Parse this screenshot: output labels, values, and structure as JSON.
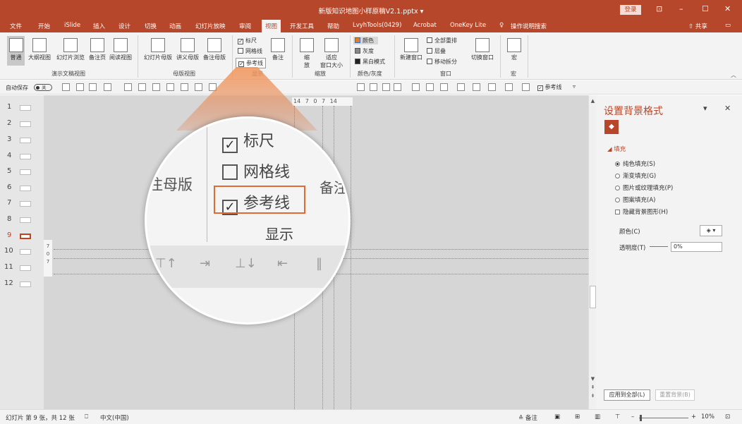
{
  "window": {
    "title": "新版知识地图小样原稿V2.1.pptx  ▾",
    "login_label": "登录",
    "controls": [
      "⊡",
      "–",
      "☐",
      "✕"
    ]
  },
  "menu": {
    "tabs": [
      "文件",
      "开始",
      "iSlide",
      "插入",
      "设计",
      "切换",
      "动画",
      "幻灯片放映",
      "审阅",
      "视图",
      "开发工具",
      "帮助",
      "LvyhTools(0429)",
      "Acrobat",
      "OneKey Lite"
    ],
    "active_tab": "视图",
    "search": "操作说明搜索",
    "share": "共享"
  },
  "ribbon": {
    "normal": "普通",
    "outline": "大纲视图",
    "sorter": "幻灯片浏览",
    "notes_page": "备注页",
    "reading": "阅读视图",
    "group_views": "演示文稿视图",
    "slide_master": "幻灯片母版",
    "handout_master": "讲义母版",
    "notes_master": "备注母版",
    "group_master": "母版视图",
    "ruler": "标尺",
    "gridlines": "网格线",
    "guides": "参考线",
    "notes": "备注",
    "group_show": "显示",
    "zoom": "缩\n放",
    "fit_window": "适应\n窗口大小",
    "group_zoom": "缩放",
    "color": "颜色",
    "grayscale": "灰度",
    "bw": "黑白模式",
    "group_color": "颜色/灰度",
    "new_window": "新建窗口",
    "arrange_all": "全部重排",
    "cascade": "层叠",
    "move_split": "移动拆分",
    "switch_window": "切换窗口",
    "group_window": "窗口",
    "macros": "宏",
    "group_macros": "宏"
  },
  "qat": {
    "autosave_label": "自动保存",
    "autosave_state": "关",
    "guides_check": "参考线"
  },
  "thumbnails": [
    "1",
    "2",
    "3",
    "4",
    "5",
    "6",
    "7",
    "8",
    "9",
    "10",
    "11",
    "12"
  ],
  "active_slide": "9",
  "ruler_text": "14  7  0  7  14",
  "vruler_text": "7\n0\n7",
  "magnifier": {
    "ruler": "标尺",
    "gridlines": "网格线",
    "guides": "参考线",
    "group": "显示",
    "left_label": "注母版",
    "right_label": "备注"
  },
  "format_pane": {
    "title": "设置背景格式",
    "section": "填充",
    "options": [
      {
        "label": "纯色填充(S)",
        "selected": true
      },
      {
        "label": "渐变填充(G)",
        "selected": false
      },
      {
        "label": "图片或纹理填充(P)",
        "selected": false
      },
      {
        "label": "图案填充(A)",
        "selected": false
      }
    ],
    "hide_bg": "隐藏背景图形(H)",
    "color_label": "颜色(C)",
    "transparency_label": "透明度(T)",
    "transparency_value": "0%",
    "apply_all": "应用到全部(L)",
    "reset": "重置背景(B)"
  },
  "status": {
    "slide_info": "幻灯片 第 9 张，共 12 张",
    "language": "中文(中国)",
    "notes": "≙ 备注",
    "zoom": "10%"
  },
  "colors": {
    "accent": "#b7472a",
    "highlight": "#e06a2f",
    "panel": "#f3f3f3"
  }
}
